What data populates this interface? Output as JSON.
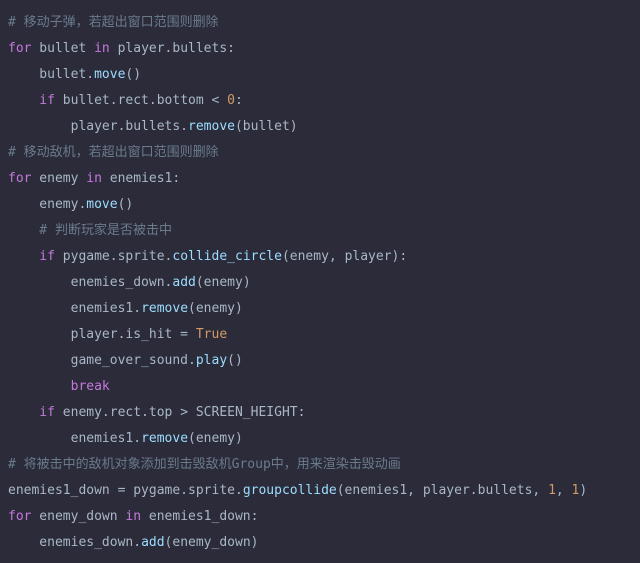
{
  "lines": {
    "l1_comment": "# 移动子弹，若超出窗口范围则删除",
    "l2_for": "for",
    "l2_bullet": " bullet ",
    "l2_in": "in",
    "l2_rest": " player.bullets:",
    "l3_text": "    bullet.",
    "l3_move": "move",
    "l3_end": "()",
    "l4_if": "    if",
    "l4_text": " bullet.rect.bottom < ",
    "l4_zero": "0",
    "l4_colon": ":",
    "l5_text": "        player.bullets.",
    "l5_remove": "remove",
    "l5_end": "(bullet)",
    "l6_empty": "",
    "l7_comment": "# 移动敌机，若超出窗口范围则删除",
    "l8_for": "for",
    "l8_enemy": " enemy ",
    "l8_in": "in",
    "l8_rest": " enemies1:",
    "l9_text": "    enemy.",
    "l9_move": "move",
    "l9_end": "()",
    "l10_comment": "    # 判断玩家是否被击中",
    "l11_if": "    if",
    "l11_text": " pygame.sprite.",
    "l11_func": "collide_circle",
    "l11_args": "(enemy, player):",
    "l12_text": "        enemies_down.",
    "l12_add": "add",
    "l12_end": "(enemy)",
    "l13_text": "        enemies1.",
    "l13_remove": "remove",
    "l13_end": "(enemy)",
    "l14_text": "        player.is_hit = ",
    "l14_true": "True",
    "l15_text": "        game_over_sound.",
    "l15_play": "play",
    "l15_end": "()",
    "l16_break": "        break",
    "l17_if": "    if",
    "l17_text": " enemy.rect.top > SCREEN_HEIGHT:",
    "l18_text": "        enemies1.",
    "l18_remove": "remove",
    "l18_end": "(enemy)",
    "l19_empty": "",
    "l20_comment": "# 将被击中的敌机对象添加到击毁敌机Group中，用来渲染击毁动画",
    "l21_text": "enemies1_down = pygame.sprite.",
    "l21_func": "groupcollide",
    "l21_args1": "(enemies1, player.bullets, ",
    "l21_one1": "1",
    "l21_comma": ", ",
    "l21_one2": "1",
    "l21_close": ")",
    "l22_for": "for",
    "l22_ed": " enemy_down ",
    "l22_in": "in",
    "l22_rest": " enemies1_down:",
    "l23_text": "    enemies_down.",
    "l23_add": "add",
    "l23_end": "(enemy_down)"
  }
}
